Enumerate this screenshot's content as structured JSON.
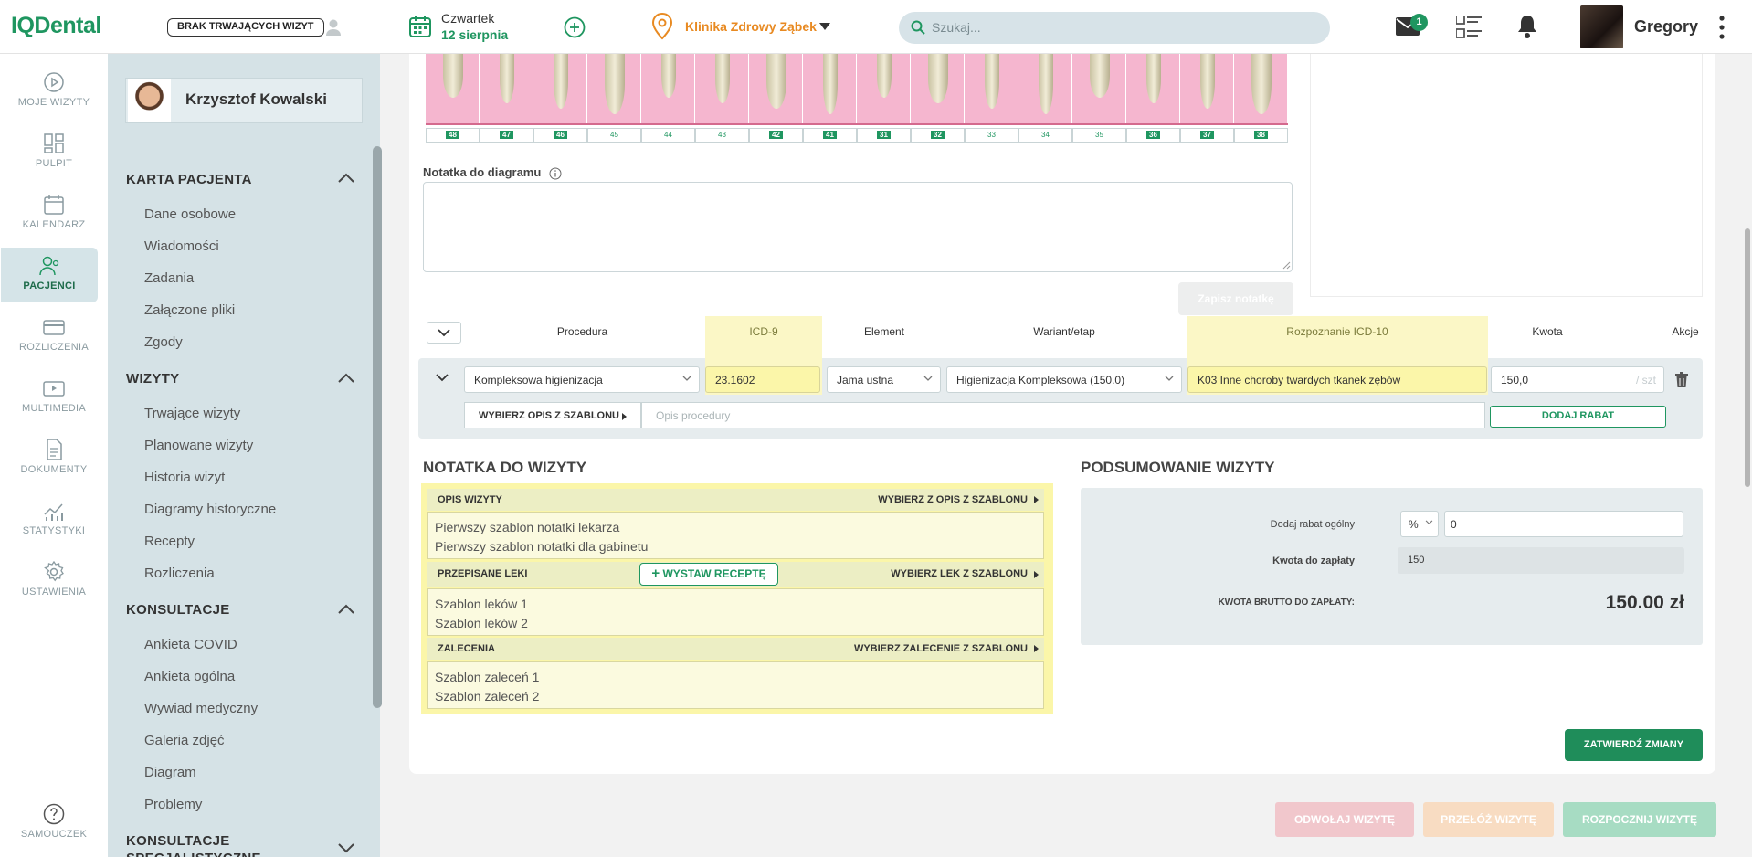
{
  "topbar": {
    "logo": "IQDental",
    "no_visits_label": "BRAK TRWAJĄCYCH WIZYT",
    "date_day": "Czwartek",
    "date_date": "12 sierpnia",
    "clinic": "Klinika Zdrowy Ząbek",
    "search_placeholder": "Szukaj...",
    "mail_badge": "1",
    "user_name": "Gregory"
  },
  "leftnav": [
    {
      "label": "MOJE WIZYTY",
      "icon": "play-circle-icon"
    },
    {
      "label": "PULPIT",
      "icon": "dashboard-icon"
    },
    {
      "label": "KALENDARZ",
      "icon": "calendar-icon"
    },
    {
      "label": "PACJENCI",
      "icon": "patients-icon",
      "active": true
    },
    {
      "label": "ROZLICZENIA",
      "icon": "card-icon"
    },
    {
      "label": "MULTIMEDIA",
      "icon": "media-icon"
    },
    {
      "label": "DOKUMENTY",
      "icon": "document-icon"
    },
    {
      "label": "STATYSTYKI",
      "icon": "stats-icon"
    },
    {
      "label": "USTAWIENIA",
      "icon": "gear-icon"
    },
    {
      "label": "SAMOUCZEK",
      "icon": "help-icon"
    }
  ],
  "sidebar": {
    "patient_name": "Krzysztof Kowalski",
    "sections": [
      {
        "title": "KARTA PACJENTA",
        "items": [
          "Dane osobowe",
          "Wiadomości",
          "Zadania",
          "Załączone pliki",
          "Zgody"
        ]
      },
      {
        "title": "WIZYTY",
        "items": [
          "Trwające wizyty",
          "Planowane wizyty",
          "Historia wizyt",
          "Diagramy historyczne",
          "Recepty",
          "Rozliczenia"
        ]
      },
      {
        "title": "KONSULTACJE",
        "items": [
          "Ankieta COVID",
          "Ankieta ogólna",
          "Wywiad medyczny",
          "Galeria zdjęć",
          "Diagram",
          "Problemy"
        ]
      },
      {
        "title": "KONSULTACJE SPECJALISTYCZNE",
        "items": []
      }
    ]
  },
  "teeth": [
    "48",
    "47",
    "46",
    "45",
    "44",
    "43",
    "42",
    "41",
    "31",
    "32",
    "33",
    "34",
    "35",
    "36",
    "37",
    "38"
  ],
  "diagram_note": {
    "label": "Notatka do diagramu",
    "save_label": "Zapisz notatkę"
  },
  "procedure_table": {
    "headers": [
      "Procedura",
      "ICD-9",
      "Element",
      "Wariant/etap",
      "Rozpoznanie ICD-10",
      "Kwota",
      "Akcje"
    ],
    "row": {
      "procedure": "Kompleksowa higienizacja",
      "icd9": "23.1602",
      "element": "Jama ustna",
      "variant": "Higienizacja Kompleksowa (150.0)",
      "icd10": "K03 Inne choroby twardych tkanek zębów",
      "amount": "150,0",
      "unit": "/ szt",
      "template_label": "WYBIERZ OPIS Z SZABLONU",
      "description_placeholder": "Opis procedury",
      "discount_label": "DODAJ RABAT"
    }
  },
  "visit_note": {
    "title": "NOTATKA DO WIZYTY",
    "opis": {
      "label": "OPIS WIZYTY",
      "action": "WYBIERZ Z OPIS Z SZABLONU",
      "lines": [
        "Pierwszy szablon notatki lekarza",
        "Pierwszy szablon notatki dla gabinetu"
      ]
    },
    "leki": {
      "label": "PRZEPISANE LEKI",
      "prescription": "WYSTAW RECEPTĘ",
      "action": "WYBIERZ LEK Z SZABLONU",
      "lines": [
        "Szablon leków 1",
        "Szablon leków 2"
      ]
    },
    "zalecenia": {
      "label": "ZALECENIA",
      "action": "WYBIERZ ZALECENIE Z SZABLONU",
      "lines": [
        "Szablon zaleceń 1",
        "Szablon zaleceń 2"
      ]
    }
  },
  "summary": {
    "title": "PODSUMOWANIE WIZYTY",
    "discount_label": "Dodaj rabat ogólny",
    "discount_unit": "%",
    "discount_value": "0",
    "to_pay_label": "Kwota do zapłaty",
    "to_pay_value": "150",
    "gross_label": "KWOTA BRUTTO DO ZAPŁATY:",
    "gross_value": "150.00 zł"
  },
  "actions": {
    "confirm": "ZATWIERDŹ ZMIANY",
    "cancel": "ODWOŁAJ WIZYTĘ",
    "reschedule": "PRZEŁÓŻ WIZYTĘ",
    "start": "ROZPOCZNIJ WIZYTĘ"
  },
  "colors": {
    "brand": "#1f9660",
    "clinic": "#e88a22",
    "highlight": "#fbf6a9"
  }
}
